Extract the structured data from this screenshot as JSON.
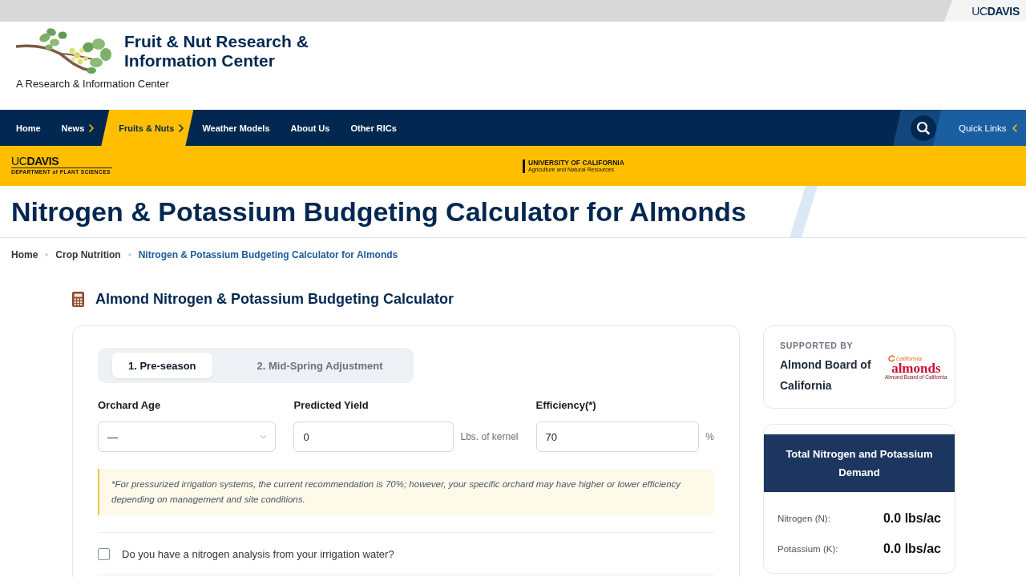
{
  "top_bar": {
    "logo": "UC**DAVIS**"
  },
  "header": {
    "title": "Fruit & Nut Research & Information Center",
    "tagline": "A Research & Information Center"
  },
  "nav": {
    "items": [
      {
        "label": "Home",
        "submenu": false,
        "selected": false
      },
      {
        "label": "News",
        "submenu": true,
        "selected": false
      },
      {
        "label": "Fruits & Nuts",
        "submenu": true,
        "selected": true
      },
      {
        "label": "Weather Models",
        "submenu": false,
        "selected": false
      },
      {
        "label": "About Us",
        "submenu": false,
        "selected": false
      },
      {
        "label": "Other RICs",
        "submenu": false,
        "selected": false
      }
    ],
    "quick_links": "Quick Links"
  },
  "banner": {
    "department_logo": {
      "wordmark": "UC**DAVIS**",
      "department": "DEPARTMENT of PLANT SCIENCES"
    },
    "partner_logo": {
      "line_1": "UNIVERSITY OF CALIFORNIA",
      "line_2": "Agriculture and Natural Resources"
    }
  },
  "page_title": "Nitrogen & Potassium Budgeting Calculator for Almonds",
  "breadcrumb": [
    {
      "label": "Home",
      "current": false
    },
    {
      "label": "Crop Nutrition",
      "current": false
    },
    {
      "label": "Nitrogen & Potassium Budgeting Calculator for Almonds",
      "current": true
    }
  ],
  "calculator": {
    "heading": "Almond Nitrogen & Potassium Budgeting Calculator",
    "tabs": [
      {
        "label": "1. Pre-season",
        "selected": true
      },
      {
        "label": "2. Mid-Spring Adjustment",
        "selected": false
      }
    ],
    "fields": [
      {
        "kind": "select",
        "label": "Orchard Age",
        "value": "—"
      },
      {
        "kind": "number",
        "label": "Predicted Yield",
        "value": "0",
        "unit": "Lbs. of kernel"
      },
      {
        "kind": "number",
        "label": "Efficiency(*)",
        "value": "70",
        "unit": "%"
      }
    ],
    "note": "*For pressurized irrigation systems, the current recommendation is 70%; however, your specific orchard may have higher or lower efficiency depending on management and site conditions.",
    "options": [
      {
        "label": "Do you have a nitrogen analysis from your irrigation water?",
        "checked": false
      }
    ]
  },
  "sidebar": {
    "sponsor": {
      "caption": "SUPPORTED BY",
      "name": "Almond Board of California",
      "logo": {
        "script": "california",
        "wordmark": "almonds",
        "tagline": "Almond Board of California"
      }
    },
    "totals": {
      "title": "Total Nitrogen and Potassium Demand",
      "rows": [
        {
          "label": "Nitrogen (N):",
          "value": "0.0 lbs/ac"
        },
        {
          "label": "Potassium (K):",
          "value": "0.0 lbs/ac"
        }
      ]
    }
  }
}
